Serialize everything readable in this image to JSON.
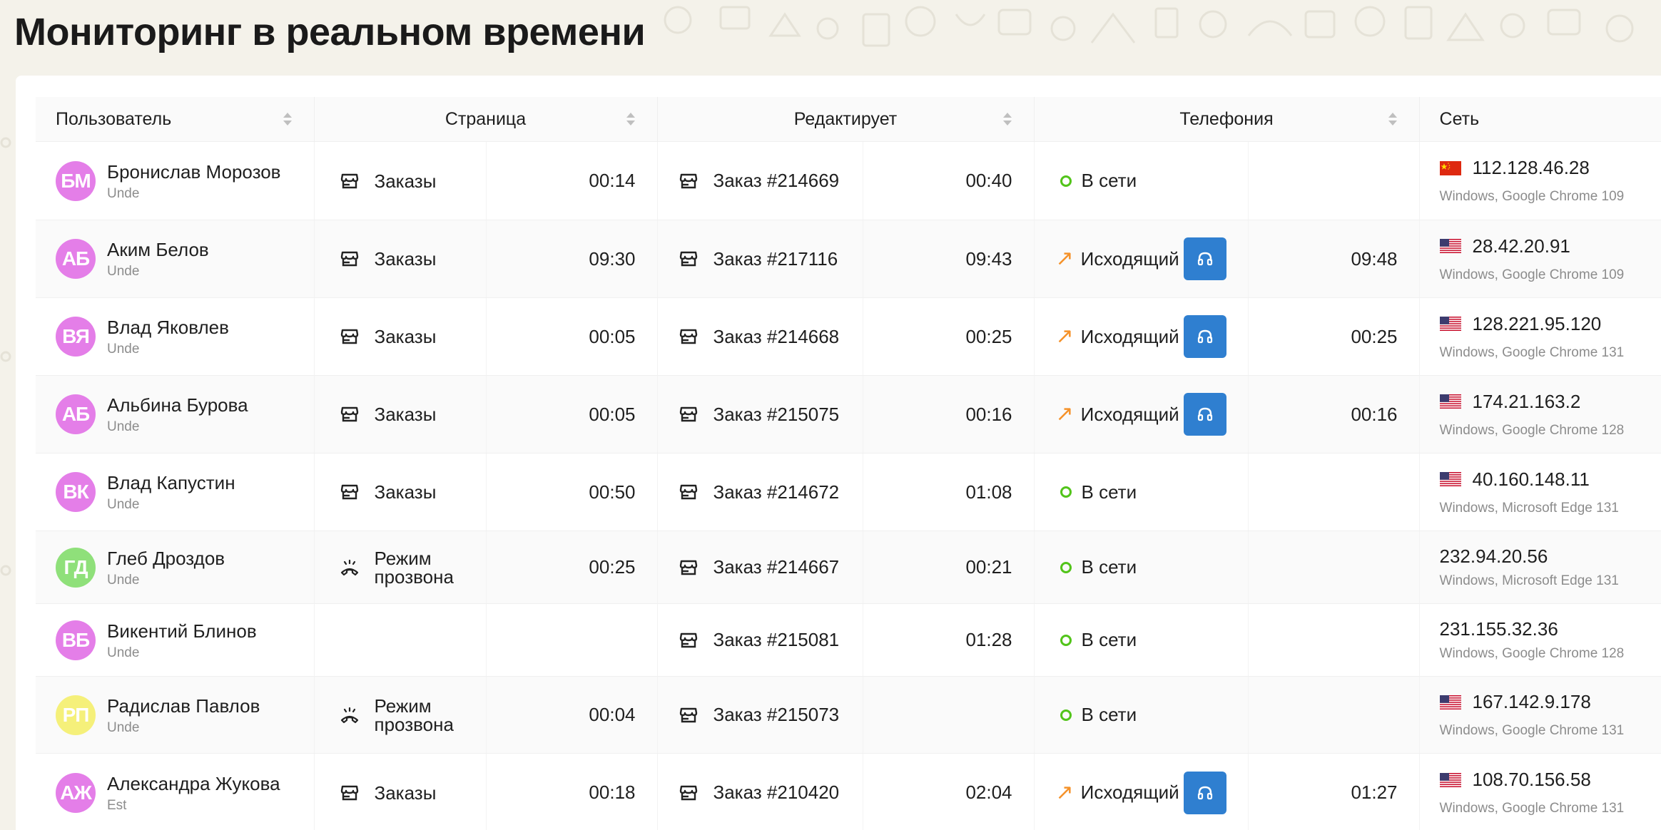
{
  "title": "Мониторинг в реальном времени",
  "colors": {
    "accent_blue": "#2f7fd0",
    "online_green": "#52c41a",
    "outgoing_orange": "#f5922a",
    "avatar_pink": "#e47ee8",
    "avatar_green": "#8fe07a",
    "avatar_yellow": "#f5f07a"
  },
  "columns": {
    "user": "Пользователь",
    "page": "Страница",
    "editing": "Редактирует",
    "telephony": "Телефония",
    "network": "Сеть"
  },
  "rows": [
    {
      "initials": "БМ",
      "name": "Бронислав Морозов",
      "role": "Unde",
      "page_icon": "store-icon",
      "page": "Заказы",
      "page_time": "00:14",
      "edit_icon": "store-icon",
      "edit": "Заказ #214669",
      "edit_time": "00:40",
      "tel_status": "В сети",
      "tel_type": "online",
      "tel_time": "",
      "flag": "cn-flag-icon",
      "ip": "112.128.46.28",
      "client": "Windows, Google Chrome 109"
    },
    {
      "initials": "АБ",
      "name": "Аким Белов",
      "role": "Unde",
      "page_icon": "store-icon",
      "page": "Заказы",
      "page_time": "09:30",
      "edit_icon": "store-icon",
      "edit": "Заказ #217116",
      "edit_time": "09:43",
      "tel_status": "Исходящий",
      "tel_type": "outgoing",
      "tel_time": "09:48",
      "flag": "us-flag-icon",
      "ip": "28.42.20.91",
      "client": "Windows, Google Chrome 109"
    },
    {
      "initials": "ВЯ",
      "name": "Влад Яковлев",
      "role": "Unde",
      "page_icon": "store-icon",
      "page": "Заказы",
      "page_time": "00:05",
      "edit_icon": "store-icon",
      "edit": "Заказ #214668",
      "edit_time": "00:25",
      "tel_status": "Исходящий",
      "tel_type": "outgoing",
      "tel_time": "00:25",
      "flag": "us-flag-icon",
      "ip": "128.221.95.120",
      "client": "Windows, Google Chrome 131"
    },
    {
      "initials": "АБ",
      "name": "Альбина Бурова",
      "role": "Unde",
      "page_icon": "store-icon",
      "page": "Заказы",
      "page_time": "00:05",
      "edit_icon": "store-icon",
      "edit": "Заказ #215075",
      "edit_time": "00:16",
      "tel_status": "Исходящий",
      "tel_type": "outgoing",
      "tel_time": "00:16",
      "flag": "us-flag-icon",
      "ip": "174.21.163.2",
      "client": "Windows, Google Chrome 128"
    },
    {
      "initials": "ВК",
      "name": "Влад Капустин",
      "role": "Unde",
      "page_icon": "store-icon",
      "page": "Заказы",
      "page_time": "00:50",
      "edit_icon": "store-icon",
      "edit": "Заказ #214672",
      "edit_time": "01:08",
      "tel_status": "В сети",
      "tel_type": "online",
      "tel_time": "",
      "flag": "us-flag-icon",
      "ip": "40.160.148.11",
      "client": "Windows, Microsoft Edge 131"
    },
    {
      "initials": "ГД",
      "name": "Глеб Дроздов",
      "role": "Unde",
      "page_icon": "dialer-icon",
      "page": "Режим прозвона",
      "page_time": "00:25",
      "edit_icon": "store-icon",
      "edit": "Заказ #214667",
      "edit_time": "00:21",
      "tel_status": "В сети",
      "tel_type": "online",
      "tel_time": "",
      "flag": "",
      "ip": "232.94.20.56",
      "client": "Windows, Microsoft Edge 131"
    },
    {
      "initials": "ВБ",
      "name": "Викентий Блинов",
      "role": "Unde",
      "page_icon": "",
      "page": "",
      "page_time": "",
      "edit_icon": "store-icon",
      "edit": "Заказ #215081",
      "edit_time": "01:28",
      "tel_status": "В сети",
      "tel_type": "online",
      "tel_time": "",
      "flag": "",
      "ip": "231.155.32.36",
      "client": "Windows, Google Chrome 128"
    },
    {
      "initials": "РП",
      "name": "Радислав Павлов",
      "role": "Unde",
      "page_icon": "dialer-icon",
      "page": "Режим прозвона",
      "page_time": "00:04",
      "edit_icon": "store-icon",
      "edit": "Заказ #215073",
      "edit_time": "",
      "tel_status": "В сети",
      "tel_type": "online",
      "tel_time": "",
      "flag": "us-flag-icon",
      "ip": "167.142.9.178",
      "client": "Windows, Google Chrome 131"
    },
    {
      "initials": "АЖ",
      "name": "Александра Жукова",
      "role": "Est",
      "page_icon": "store-icon",
      "page": "Заказы",
      "page_time": "00:18",
      "edit_icon": "store-icon",
      "edit": "Заказ #210420",
      "edit_time": "02:04",
      "tel_status": "Исходящий",
      "tel_type": "outgoing",
      "tel_time": "01:27",
      "flag": "us-flag-icon",
      "ip": "108.70.156.58",
      "client": "Windows, Google Chrome 131"
    }
  ]
}
